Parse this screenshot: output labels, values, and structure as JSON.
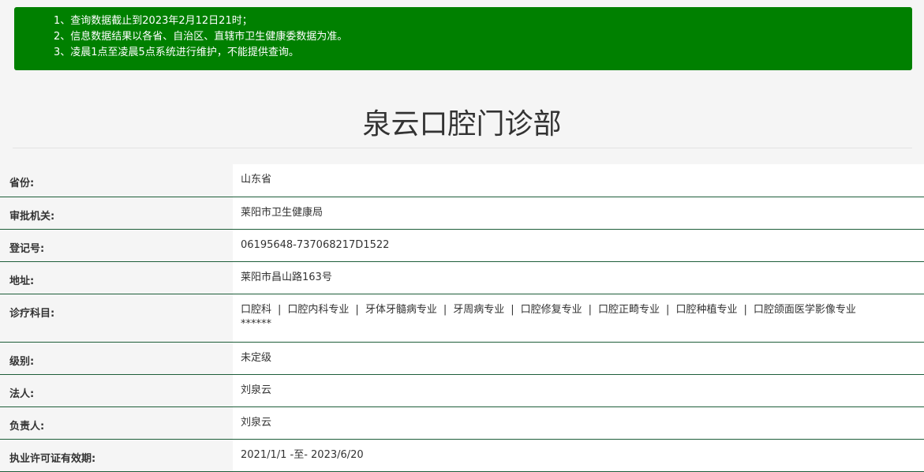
{
  "notice": {
    "lines": [
      "1、查询数据截止到2023年2月12日21时；",
      "2、信息数据结果以各省、自治区、直辖市卫生健康委数据为准。",
      "3、凌晨1点至凌晨5点系统进行维护，不能提供查询。"
    ]
  },
  "title": "泉云口腔门诊部",
  "fields": {
    "province": {
      "label": "省份:",
      "value": "山东省"
    },
    "authority": {
      "label": "审批机关:",
      "value": "莱阳市卫生健康局"
    },
    "reg_no": {
      "label": "登记号:",
      "value": "06195648-737068217D1522"
    },
    "address": {
      "label": "地址:",
      "value": "莱阳市昌山路163号"
    },
    "departments": {
      "label": "诊疗科目:",
      "items": [
        "口腔科",
        "口腔内科专业",
        "牙体牙髓病专业",
        "牙周病专业",
        "口腔修复专业",
        "口腔正畸专业",
        "口腔种植专业",
        "口腔颌面医学影像专业"
      ],
      "separator": "|",
      "extra": "******"
    },
    "level": {
      "label": "级别:",
      "value": "未定级"
    },
    "legal_person": {
      "label": "法人:",
      "value": "刘泉云"
    },
    "person_in_charge": {
      "label": "负责人:",
      "value": "刘泉云"
    },
    "license_validity": {
      "label": "执业许可证有效期:",
      "value": "2021/1/1 -至- 2023/6/20"
    }
  },
  "colors": {
    "notice_bg": "#008000",
    "row_border": "#1e5e3a",
    "page_bg": "#f5f5f5"
  }
}
